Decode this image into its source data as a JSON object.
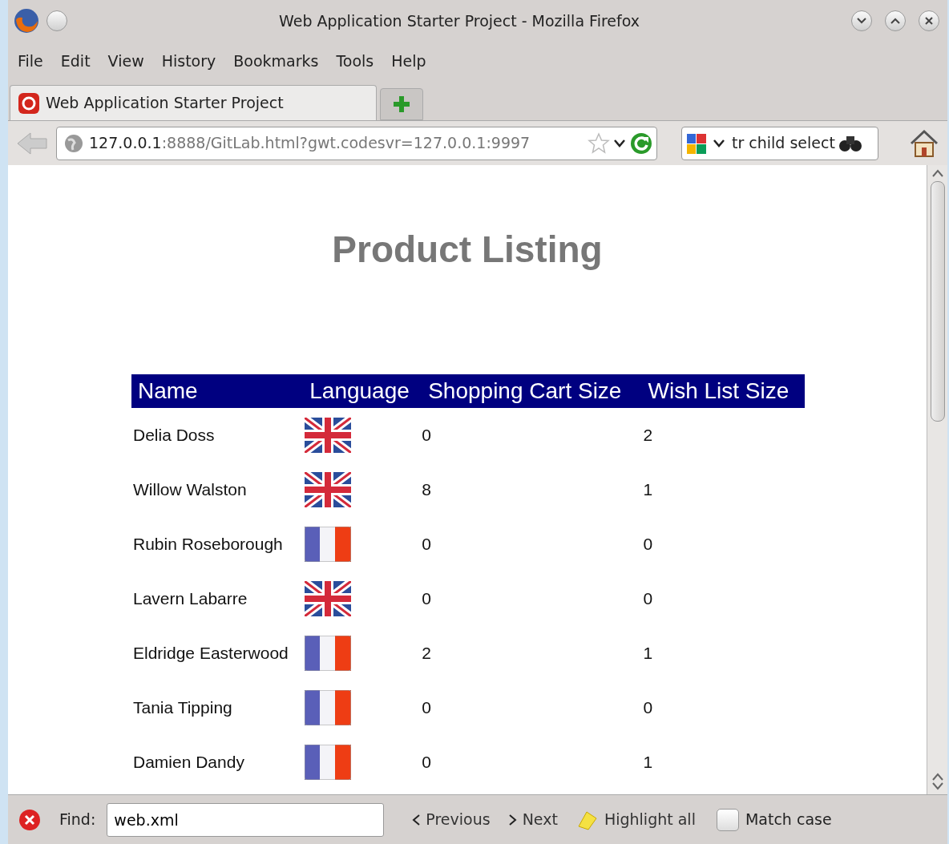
{
  "window": {
    "title": "Web Application Starter Project - Mozilla Firefox"
  },
  "menu": [
    "File",
    "Edit",
    "View",
    "History",
    "Bookmarks",
    "Tools",
    "Help"
  ],
  "tabs": [
    {
      "label": "Web Application Starter Project",
      "selected": true
    }
  ],
  "address_bar": {
    "host": "127.0.0.1",
    "rest": ":8888/GitLab.html?gwt.codesvr=127.0.0.1:9997"
  },
  "search_bar": {
    "value": "tr child select"
  },
  "page": {
    "heading": "Product Listing",
    "table": {
      "columns": [
        "Name",
        "Language",
        "Shopping Cart Size",
        "Wish List Size"
      ],
      "rows": [
        {
          "name": "Delia Doss",
          "kind": "uk",
          "cart": "0",
          "wish": "2"
        },
        {
          "name": "Willow Walston",
          "kind": "uk",
          "cart": "8",
          "wish": "1"
        },
        {
          "name": "Rubin Roseborough",
          "kind": "fr",
          "cart": "0",
          "wish": "0"
        },
        {
          "name": "Lavern Labarre",
          "kind": "uk",
          "cart": "0",
          "wish": "0"
        },
        {
          "name": "Eldridge Easterwood",
          "kind": "fr",
          "cart": "2",
          "wish": "1"
        },
        {
          "name": "Tania Tipping",
          "kind": "fr",
          "cart": "0",
          "wish": "0"
        },
        {
          "name": "Damien Dandy",
          "kind": "fr",
          "cart": "0",
          "wish": "1"
        }
      ]
    }
  },
  "find_bar": {
    "label": "Find:",
    "value": "web.xml",
    "previous": "Previous",
    "next": "Next",
    "highlight_all": "Highlight all",
    "match_case": {
      "label": "Match case",
      "checked": false
    }
  }
}
